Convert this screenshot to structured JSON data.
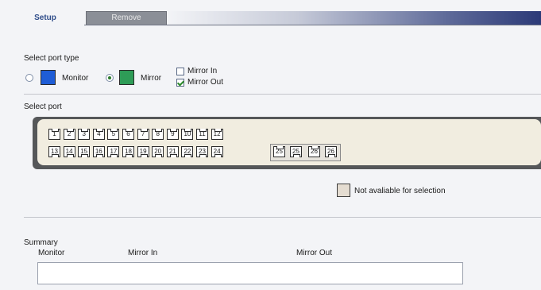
{
  "tabs": {
    "setup": "Setup",
    "remove": "Remove"
  },
  "port_type": {
    "heading": "Select port type",
    "monitor": {
      "label": "Monitor",
      "selected": false,
      "color": "#1f5dd6"
    },
    "mirror": {
      "label": "Mirror",
      "selected": true,
      "color": "#2e9c57"
    },
    "mirror_in": {
      "label": "Mirror In",
      "checked": false
    },
    "mirror_out": {
      "label": "Mirror Out",
      "checked": true
    }
  },
  "select_port": {
    "heading": "Select port",
    "top_row": [
      "1",
      "2",
      "3",
      "4",
      "5",
      "6",
      "7",
      "8",
      "9",
      "10",
      "11",
      "12"
    ],
    "bottom_row": [
      "13",
      "14",
      "15",
      "16",
      "17",
      "18",
      "19",
      "20",
      "21",
      "22",
      "23",
      "24"
    ],
    "sfp_ports": [
      "25",
      "25",
      "26",
      "26"
    ]
  },
  "legend": {
    "not_available": "Not avaliable for selection"
  },
  "summary": {
    "heading": "Summary",
    "col_monitor": "Monitor",
    "col_mirror_in": "Mirror In",
    "col_mirror_out": "Mirror Out",
    "value": ""
  }
}
